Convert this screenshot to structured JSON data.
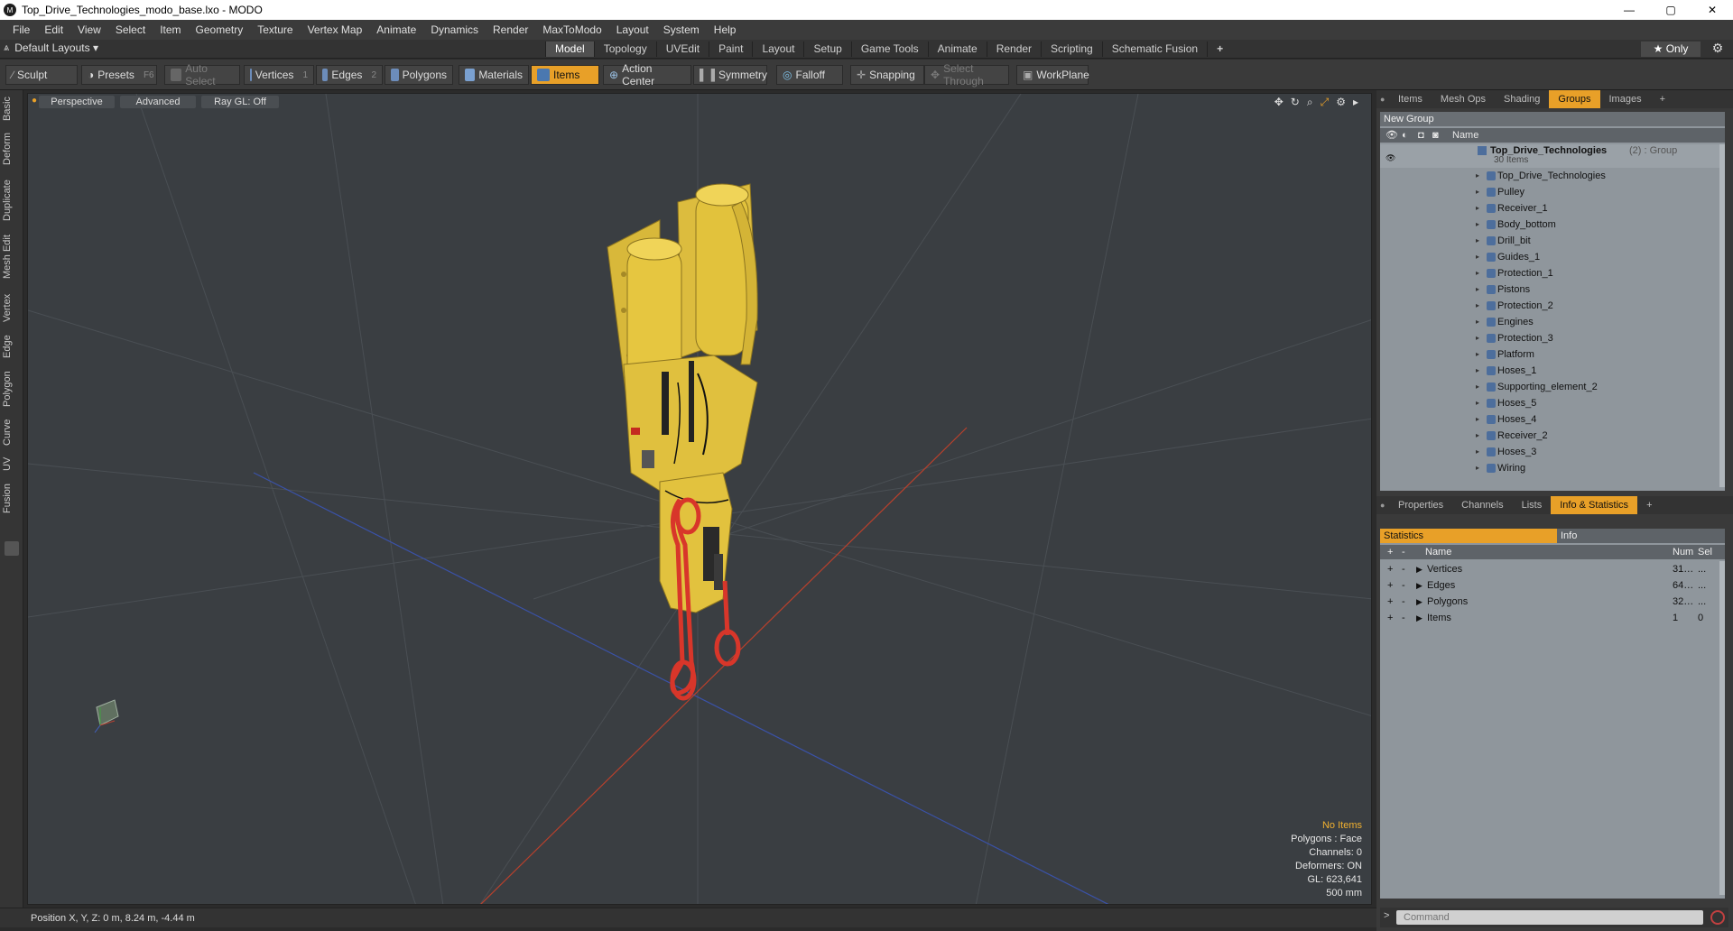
{
  "window": {
    "title": "Top_Drive_Technologies_modo_base.lxo - MODO",
    "app_icon": "M",
    "minimize": "—",
    "maximize": "▢",
    "close": "✕"
  },
  "menu": [
    "File",
    "Edit",
    "View",
    "Select",
    "Item",
    "Geometry",
    "Texture",
    "Vertex Map",
    "Animate",
    "Dynamics",
    "Render",
    "MaxToModo",
    "Layout",
    "System",
    "Help"
  ],
  "layout": {
    "name": "Default Layouts ▾",
    "modes": [
      "Model",
      "Topology",
      "UVEdit",
      "Paint",
      "Layout",
      "Setup",
      "Game Tools",
      "Animate",
      "Render",
      "Scripting",
      "Schematic Fusion"
    ],
    "active_mode": "Model",
    "add": "+",
    "only": "★  Only"
  },
  "toolbar": {
    "sculpt": "Sculpt",
    "presets": "Presets",
    "presets_key": "F6",
    "auto_select": "Auto Select",
    "vertices": "Vertices",
    "vertices_key": "1",
    "edges": "Edges",
    "edges_key": "2",
    "polygons": "Polygons",
    "materials": "Materials",
    "items": "Items",
    "action_center": "Action Center",
    "symmetry": "Symmetry",
    "falloff": "Falloff",
    "snapping": "Snapping",
    "select_through": "Select Through",
    "workplane": "WorkPlane"
  },
  "left_tabs": [
    "Basic",
    "Deform",
    "Duplicate",
    "Mesh Edit",
    "Vertex",
    "Edge",
    "Polygon",
    "Curve",
    "UV",
    "Fusion"
  ],
  "viewport": {
    "view": "Perspective",
    "shading": "Advanced",
    "raygl": "Ray GL: Off",
    "info": {
      "items": "No Items",
      "polygons": "Polygons : Face",
      "channels": "Channels: 0",
      "deformers": "Deformers: ON",
      "gl": "GL: 623,641",
      "scale": "500 mm"
    }
  },
  "status": {
    "position": "Position X, Y, Z:  0 m, 8.24 m, -4.44 m"
  },
  "right_panel": {
    "top_tabs": [
      "Items",
      "Mesh Ops",
      "Shading",
      "Groups",
      "Images"
    ],
    "active_top_tab": "Groups",
    "new_group": "New Group",
    "name_header": "Name",
    "group": {
      "name": "Top_Drive_Technologies",
      "count_suffix": " (2) : Group",
      "sub": "30 Items"
    },
    "items": [
      "Top_Drive_Technologies",
      "Pulley",
      "Receiver_1",
      "Body_bottom",
      "Drill_bit",
      "Guides_1",
      "Protection_1",
      "Pistons",
      "Protection_2",
      "Engines",
      "Protection_3",
      "Platform",
      "Hoses_1",
      "Supporting_element_2",
      "Hoses_5",
      "Hoses_4",
      "Receiver_2",
      "Hoses_3",
      "Wiring"
    ],
    "bottom_tabs": [
      "Properties",
      "Channels",
      "Lists",
      "Info & Statistics"
    ],
    "active_bottom_tab": "Info & Statistics",
    "stats_tabs": [
      "Statistics",
      "Info"
    ],
    "stats_headers": {
      "name": "Name",
      "num": "Num",
      "sel": "Sel"
    },
    "stats": [
      {
        "name": "Vertices",
        "num": "31…",
        "sel": "..."
      },
      {
        "name": "Edges",
        "num": "64…",
        "sel": "..."
      },
      {
        "name": "Polygons",
        "num": "32…",
        "sel": "..."
      },
      {
        "name": "Items",
        "num": "1",
        "sel": "0"
      }
    ],
    "command_placeholder": "Command"
  },
  "colors": {
    "accent": "#e8a028",
    "model_yellow": "#e6c640",
    "model_red": "#d8362a"
  }
}
